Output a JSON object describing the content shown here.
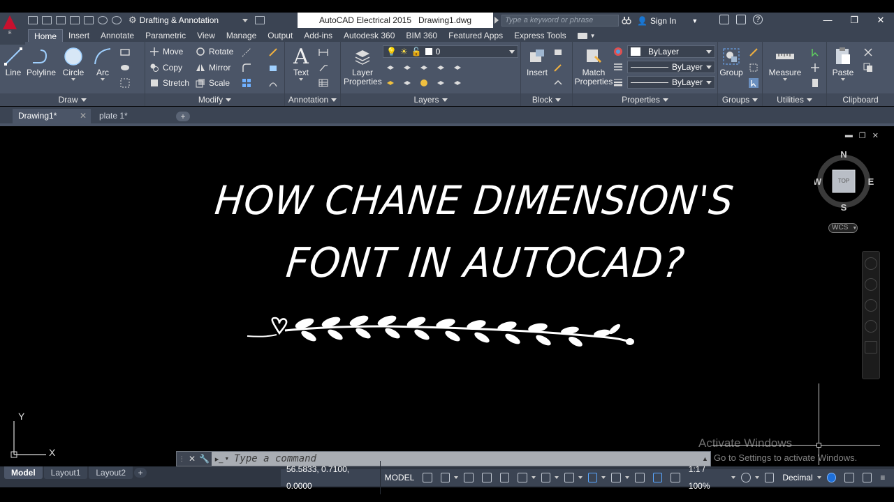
{
  "app": {
    "window_title": "AutoCAD Electrical 2015",
    "document_name": "Drawing1.dwg",
    "app_button_letter": "E",
    "workspace": "Drafting & Annotation",
    "search_placeholder": "Type a keyword or phrase",
    "sign_in": "Sign In",
    "help": "?"
  },
  "ribbon_tabs": [
    "Home",
    "Insert",
    "Annotate",
    "Parametric",
    "View",
    "Manage",
    "Output",
    "Add-ins",
    "Autodesk 360",
    "BIM 360",
    "Featured Apps",
    "Express Tools"
  ],
  "panels": {
    "draw": {
      "title": "Draw",
      "tools": [
        "Line",
        "Polyline",
        "Circle",
        "Arc"
      ]
    },
    "modify": {
      "title": "Modify",
      "tools": [
        "Move",
        "Rotate",
        "Copy",
        "Mirror",
        "Stretch",
        "Scale"
      ]
    },
    "annotation": {
      "title": "Annotation",
      "text_tool": "Text"
    },
    "layers": {
      "title": "Layers",
      "layer_properties_1": "Layer",
      "layer_properties_2": "Properties",
      "current_layer": "0"
    },
    "block": {
      "title": "Block",
      "insert": "Insert"
    },
    "properties": {
      "title": "Properties",
      "match_1": "Match",
      "match_2": "Properties",
      "color": "ByLayer",
      "linetype": "ByLayer",
      "lineweight": "ByLayer"
    },
    "groups": {
      "title": "Groups",
      "group": "Group"
    },
    "utilities": {
      "title": "Utilities",
      "measure": "Measure"
    },
    "clipboard": {
      "title": "Clipboard",
      "paste": "Paste"
    }
  },
  "doc_tabs": [
    {
      "label": "Drawing1*",
      "active": true
    },
    {
      "label": "plate 1*",
      "active": false
    }
  ],
  "drawing": {
    "headline_line1": "HOW CHANE DIMENSION'S",
    "headline_line2": "FONT IN AUTOCAD?"
  },
  "viewcube": {
    "north": "N",
    "south": "S",
    "east": "E",
    "west": "W",
    "face": "TOP",
    "wcs": "WCS"
  },
  "ucs": {
    "x": "X",
    "y": "Y"
  },
  "watermark": {
    "line1": "Activate Windows",
    "line2": "Go to Settings to activate Windows."
  },
  "command_line": {
    "placeholder": "Type a command"
  },
  "layout_tabs": [
    "Model",
    "Layout1",
    "Layout2"
  ],
  "status_bar": {
    "coordinates": "56.5833, 0.7100, 0.0000",
    "space": "MODEL",
    "scale": "1:1 / 100%",
    "units": "Decimal"
  },
  "colors": {
    "ribbon_bg": "#4b5567",
    "titlebar_bg": "#3b4453",
    "canvas_bg": "#000000",
    "autocad_red": "#c8102e"
  }
}
